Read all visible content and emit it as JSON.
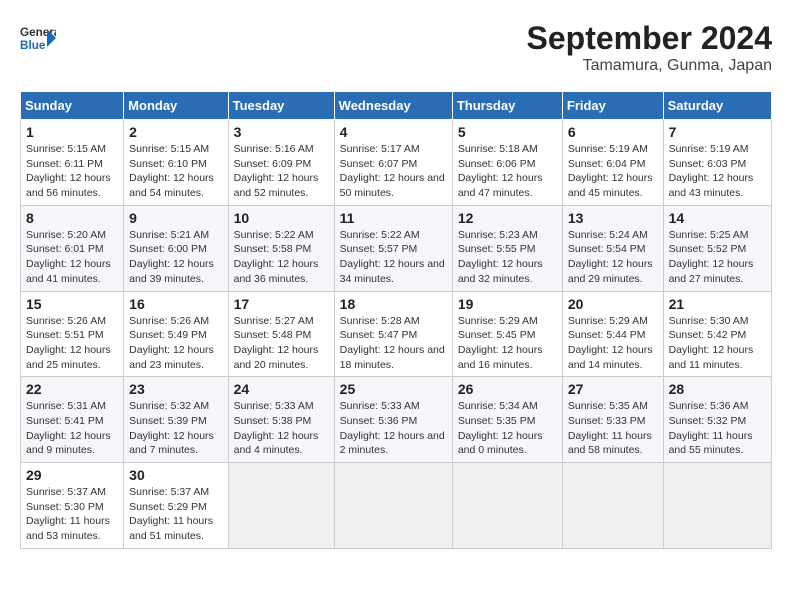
{
  "header": {
    "logo": {
      "general": "General",
      "blue": "Blue"
    },
    "title": "September 2024",
    "location": "Tamamura, Gunma, Japan"
  },
  "weekdays": [
    "Sunday",
    "Monday",
    "Tuesday",
    "Wednesday",
    "Thursday",
    "Friday",
    "Saturday"
  ],
  "weeks": [
    [
      {
        "day": "1",
        "sunrise": "5:15 AM",
        "sunset": "6:11 PM",
        "daylight": "12 hours and 56 minutes."
      },
      {
        "day": "2",
        "sunrise": "5:15 AM",
        "sunset": "6:10 PM",
        "daylight": "12 hours and 54 minutes."
      },
      {
        "day": "3",
        "sunrise": "5:16 AM",
        "sunset": "6:09 PM",
        "daylight": "12 hours and 52 minutes."
      },
      {
        "day": "4",
        "sunrise": "5:17 AM",
        "sunset": "6:07 PM",
        "daylight": "12 hours and 50 minutes."
      },
      {
        "day": "5",
        "sunrise": "5:18 AM",
        "sunset": "6:06 PM",
        "daylight": "12 hours and 47 minutes."
      },
      {
        "day": "6",
        "sunrise": "5:19 AM",
        "sunset": "6:04 PM",
        "daylight": "12 hours and 45 minutes."
      },
      {
        "day": "7",
        "sunrise": "5:19 AM",
        "sunset": "6:03 PM",
        "daylight": "12 hours and 43 minutes."
      }
    ],
    [
      {
        "day": "8",
        "sunrise": "5:20 AM",
        "sunset": "6:01 PM",
        "daylight": "12 hours and 41 minutes."
      },
      {
        "day": "9",
        "sunrise": "5:21 AM",
        "sunset": "6:00 PM",
        "daylight": "12 hours and 39 minutes."
      },
      {
        "day": "10",
        "sunrise": "5:22 AM",
        "sunset": "5:58 PM",
        "daylight": "12 hours and 36 minutes."
      },
      {
        "day": "11",
        "sunrise": "5:22 AM",
        "sunset": "5:57 PM",
        "daylight": "12 hours and 34 minutes."
      },
      {
        "day": "12",
        "sunrise": "5:23 AM",
        "sunset": "5:55 PM",
        "daylight": "12 hours and 32 minutes."
      },
      {
        "day": "13",
        "sunrise": "5:24 AM",
        "sunset": "5:54 PM",
        "daylight": "12 hours and 29 minutes."
      },
      {
        "day": "14",
        "sunrise": "5:25 AM",
        "sunset": "5:52 PM",
        "daylight": "12 hours and 27 minutes."
      }
    ],
    [
      {
        "day": "15",
        "sunrise": "5:26 AM",
        "sunset": "5:51 PM",
        "daylight": "12 hours and 25 minutes."
      },
      {
        "day": "16",
        "sunrise": "5:26 AM",
        "sunset": "5:49 PM",
        "daylight": "12 hours and 23 minutes."
      },
      {
        "day": "17",
        "sunrise": "5:27 AM",
        "sunset": "5:48 PM",
        "daylight": "12 hours and 20 minutes."
      },
      {
        "day": "18",
        "sunrise": "5:28 AM",
        "sunset": "5:47 PM",
        "daylight": "12 hours and 18 minutes."
      },
      {
        "day": "19",
        "sunrise": "5:29 AM",
        "sunset": "5:45 PM",
        "daylight": "12 hours and 16 minutes."
      },
      {
        "day": "20",
        "sunrise": "5:29 AM",
        "sunset": "5:44 PM",
        "daylight": "12 hours and 14 minutes."
      },
      {
        "day": "21",
        "sunrise": "5:30 AM",
        "sunset": "5:42 PM",
        "daylight": "12 hours and 11 minutes."
      }
    ],
    [
      {
        "day": "22",
        "sunrise": "5:31 AM",
        "sunset": "5:41 PM",
        "daylight": "12 hours and 9 minutes."
      },
      {
        "day": "23",
        "sunrise": "5:32 AM",
        "sunset": "5:39 PM",
        "daylight": "12 hours and 7 minutes."
      },
      {
        "day": "24",
        "sunrise": "5:33 AM",
        "sunset": "5:38 PM",
        "daylight": "12 hours and 4 minutes."
      },
      {
        "day": "25",
        "sunrise": "5:33 AM",
        "sunset": "5:36 PM",
        "daylight": "12 hours and 2 minutes."
      },
      {
        "day": "26",
        "sunrise": "5:34 AM",
        "sunset": "5:35 PM",
        "daylight": "12 hours and 0 minutes."
      },
      {
        "day": "27",
        "sunrise": "5:35 AM",
        "sunset": "5:33 PM",
        "daylight": "11 hours and 58 minutes."
      },
      {
        "day": "28",
        "sunrise": "5:36 AM",
        "sunset": "5:32 PM",
        "daylight": "11 hours and 55 minutes."
      }
    ],
    [
      {
        "day": "29",
        "sunrise": "5:37 AM",
        "sunset": "5:30 PM",
        "daylight": "11 hours and 53 minutes."
      },
      {
        "day": "30",
        "sunrise": "5:37 AM",
        "sunset": "5:29 PM",
        "daylight": "11 hours and 51 minutes."
      },
      null,
      null,
      null,
      null,
      null
    ]
  ]
}
